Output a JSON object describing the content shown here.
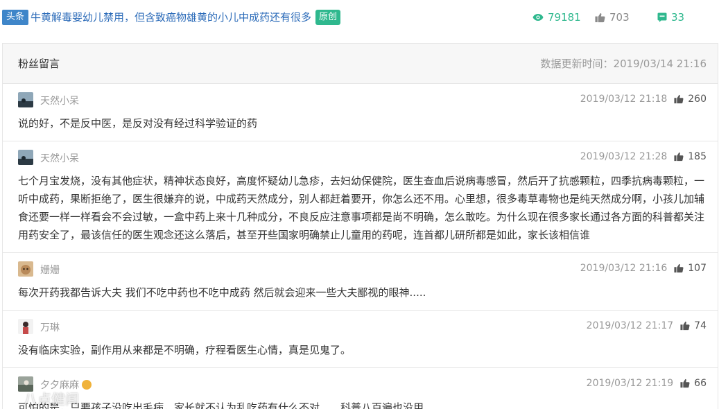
{
  "header": {
    "source_tag": "头条",
    "title": "牛黄解毒婴幼儿禁用，但含致癌物雄黄的小儿中成药还有很多",
    "original_tag": "原创",
    "views": "79181",
    "likes": "703",
    "comments": "33"
  },
  "panel": {
    "title": "粉丝留言",
    "updated": "数据更新时间：2019/03/14 21:16"
  },
  "comments": [
    {
      "name": "天然小呆",
      "time": "2019/03/12 21:18",
      "likes": "260",
      "text": "说的好，不是反中医，是反对没有经过科学验证的药"
    },
    {
      "name": "天然小呆",
      "time": "2019/03/12 21:28",
      "likes": "185",
      "text": "七个月宝发烧，没有其他症状，精神状态良好，高度怀疑幼儿急疹，去妇幼保健院，医生查血后说病毒感冒，然后开了抗感颗粒，四季抗病毒颗粒，一听中成药，果断拒绝了，医生很嫌弃的说，中成药天然成分，别人都赶着要开，你怎么还不用。心里想，很多毒草毒物也是纯天然成分啊，小孩儿加辅食还要一样一样看会不会过敏，一盒中药上来十几种成分，不良反应注意事项都是尚不明确，怎么敢吃。为什么现在很多家长通过各方面的科普都关注用药安全了，最该信任的医生观念还这么落后，甚至开些国家明确禁止儿童用的药呢，连首都儿研所都是如此，家长该相信谁"
    },
    {
      "name": "姗姗",
      "time": "2019/03/12 21:16",
      "likes": "107",
      "text": "每次开药我都告诉大夫 我们不吃中药也不吃中成药 然后就会迎来一些大夫鄙视的眼神....."
    },
    {
      "name": "万琳",
      "time": "2019/03/12 21:17",
      "likes": "74",
      "text": "没有临床实验，副作用从来都是不明确，疗程看医生心情，真是见鬼了。"
    },
    {
      "name": "夕夕麻麻",
      "time": "2019/03/12 21:19",
      "likes": "66",
      "text": "可怕的是，只要孩子没吃出毛病，家长就不认为乱吃药有什么不对……科普八百遍也没用"
    }
  ],
  "watermark": "八点健闻",
  "colors": {
    "accent_green": "#2fb88e",
    "link_blue": "#2a6ab8",
    "tag_blue": "#3f86c9"
  },
  "icons": {
    "views": "eye-icon",
    "likes": "thumbs-up-icon",
    "comments": "comment-icon"
  }
}
